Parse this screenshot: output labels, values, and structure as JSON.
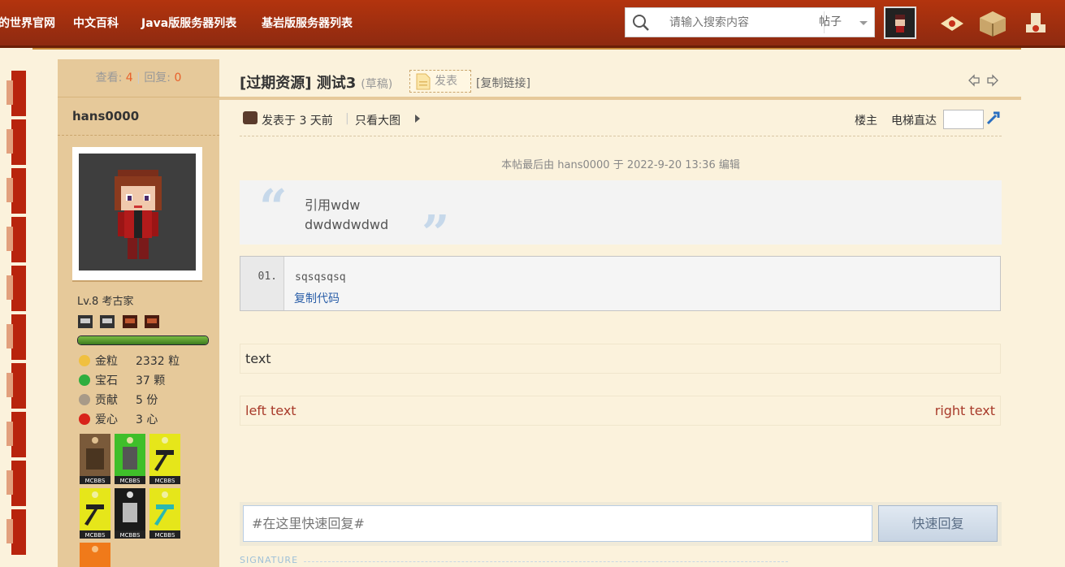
{
  "nav": {
    "items": [
      "的世界官网",
      "中文百科",
      "Java版服务器列表",
      "基岩版服务器列表"
    ]
  },
  "search": {
    "placeholder": "请输入搜索内容",
    "type": "帖子"
  },
  "sidebar": {
    "views_label": "查看:",
    "views": "4",
    "replies_label": "回复:",
    "replies": "0",
    "username": "hans0000",
    "level": "Lv.8 考古家",
    "resources": [
      {
        "label": "金粒",
        "value": "2332 粒",
        "icon": "gold-nugget-icon"
      },
      {
        "label": "宝石",
        "value": "37 颗",
        "icon": "emerald-icon"
      },
      {
        "label": "贡献",
        "value": "5 份",
        "icon": "contribution-icon"
      },
      {
        "label": "爱心",
        "value": "3 心",
        "icon": "apple-icon"
      }
    ],
    "medal_text": "MCBBS",
    "xp_fraction": 1.0
  },
  "post": {
    "title": "[过期资源] 测试3",
    "draft": "(草稿)",
    "publish": "发表",
    "copy_link": "[复制链接]",
    "posted": "发表于 3 天前",
    "sep": "|",
    "view_big": "只看大图",
    "op": "楼主",
    "elevator": "电梯直达",
    "edited": "本帖最后由 hans0000 于 2022-9-20 13:36 编辑",
    "quote_lines": [
      "引用wdw",
      "dwdwdwdwd"
    ],
    "code_line_no": "01.",
    "code_text": "sqsqsqsq",
    "copy_code": "复制代码",
    "text": "text",
    "left_text": "left text",
    "right_text": "right text"
  },
  "reply": {
    "placeholder": "#在这里快速回复#",
    "button": "快速回复"
  },
  "signature": "SIGNATURE",
  "colors": {
    "topbar": "#a8300e",
    "accent_link": "#2a5ea8",
    "left_right_text": "#a83a2a",
    "count": "#e8602a"
  }
}
